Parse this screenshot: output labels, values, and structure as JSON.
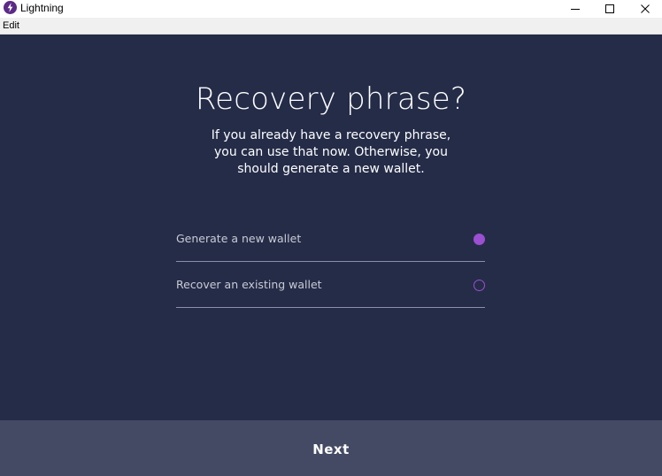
{
  "window": {
    "title": "Lightning",
    "app_icon": "lightning-bolt-icon",
    "controls": [
      "minimize-icon",
      "maximize-icon",
      "close-icon"
    ]
  },
  "menu": {
    "items": [
      {
        "label": "Edit"
      }
    ]
  },
  "main": {
    "title": "Recovery phrase?",
    "subtitle": "If you already have a recovery phrase, you can use that now. Otherwise, you should generate a new wallet.",
    "options": [
      {
        "label": "Generate a new wallet",
        "selected": true
      },
      {
        "label": "Recover an existing wallet",
        "selected": false
      }
    ]
  },
  "footer": {
    "next_label": "Next"
  },
  "colors": {
    "background": "#252c48",
    "footer": "#444a64",
    "accent": "#9b4fd1",
    "divider": "#8d8fa8"
  }
}
